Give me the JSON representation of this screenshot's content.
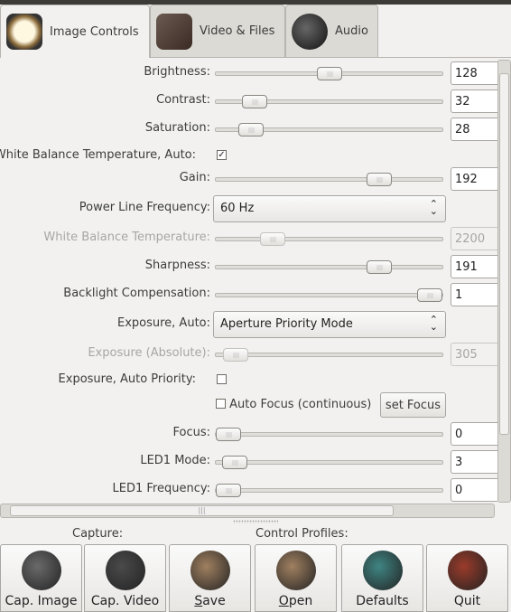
{
  "tabs": [
    {
      "label": "Image Controls",
      "icon": "tv-icon",
      "active": true
    },
    {
      "label": "Video & Files",
      "icon": "film-icon"
    },
    {
      "label": "Audio",
      "icon": "microphone-icon"
    }
  ],
  "controls": [
    {
      "label": "Brightness:",
      "type": "slider",
      "value": "128",
      "level": 0.5
    },
    {
      "label": "Contrast:",
      "type": "slider",
      "value": "32",
      "level": 0.13
    },
    {
      "label": "Saturation:",
      "type": "slider",
      "value": "28",
      "level": 0.11
    },
    {
      "label": "White Balance Temperature, Auto:",
      "type": "checkbox",
      "checked": true
    },
    {
      "label": "Gain:",
      "type": "slider",
      "value": "192",
      "level": 0.75
    },
    {
      "label": "Power Line Frequency:",
      "type": "combo",
      "value": "60 Hz"
    },
    {
      "label": "White Balance Temperature:",
      "type": "slider",
      "value": "2200",
      "level": 0.22,
      "disabled": true
    },
    {
      "label": "Sharpness:",
      "type": "slider",
      "value": "191",
      "level": 0.75
    },
    {
      "label": "Backlight Compensation:",
      "type": "slider",
      "value": "1",
      "level": 1
    },
    {
      "label": "Exposure, Auto:",
      "type": "combo",
      "value": "Aperture Priority Mode"
    },
    {
      "label": "Exposure (Absolute):",
      "type": "slider",
      "value": "305",
      "level": 0.035,
      "disabled": true
    },
    {
      "label": "Exposure, Auto Priority:",
      "type": "checkbox",
      "checked": false
    },
    {
      "label": "Auto Focus (continuous)",
      "type": "autofocus",
      "checked": false,
      "button": "set Focus"
    },
    {
      "label": "Focus:",
      "type": "slider",
      "value": "0",
      "level": 0
    },
    {
      "label": "LED1 Mode:",
      "type": "slider",
      "value": "3",
      "level": 0.03
    },
    {
      "label": "LED1 Frequency:",
      "type": "slider",
      "value": "0",
      "level": 0
    }
  ],
  "bottom": {
    "capture_label": "Capture:",
    "profiles_label": "Control Profiles:",
    "buttons": [
      {
        "label": "Cap. Image",
        "icon": "camera-icon",
        "color": "#6a6a6a"
      },
      {
        "label": "Cap. Video",
        "icon": "video-camera-icon",
        "color": "#4a4a4a"
      },
      {
        "label": "Save",
        "icon": "folder-save-icon",
        "color": "#a08060",
        "mnemonic": "S",
        "rest": "ave"
      },
      {
        "label": "Open",
        "icon": "folder-open-icon",
        "color": "#a08060",
        "mnemonic": "O",
        "rest": "pen"
      },
      {
        "label": "Defaults",
        "icon": "reset-icon",
        "color": "#3f8583"
      },
      {
        "label": "Quit",
        "icon": "quit-icon",
        "color": "#9a3b2a"
      }
    ]
  }
}
